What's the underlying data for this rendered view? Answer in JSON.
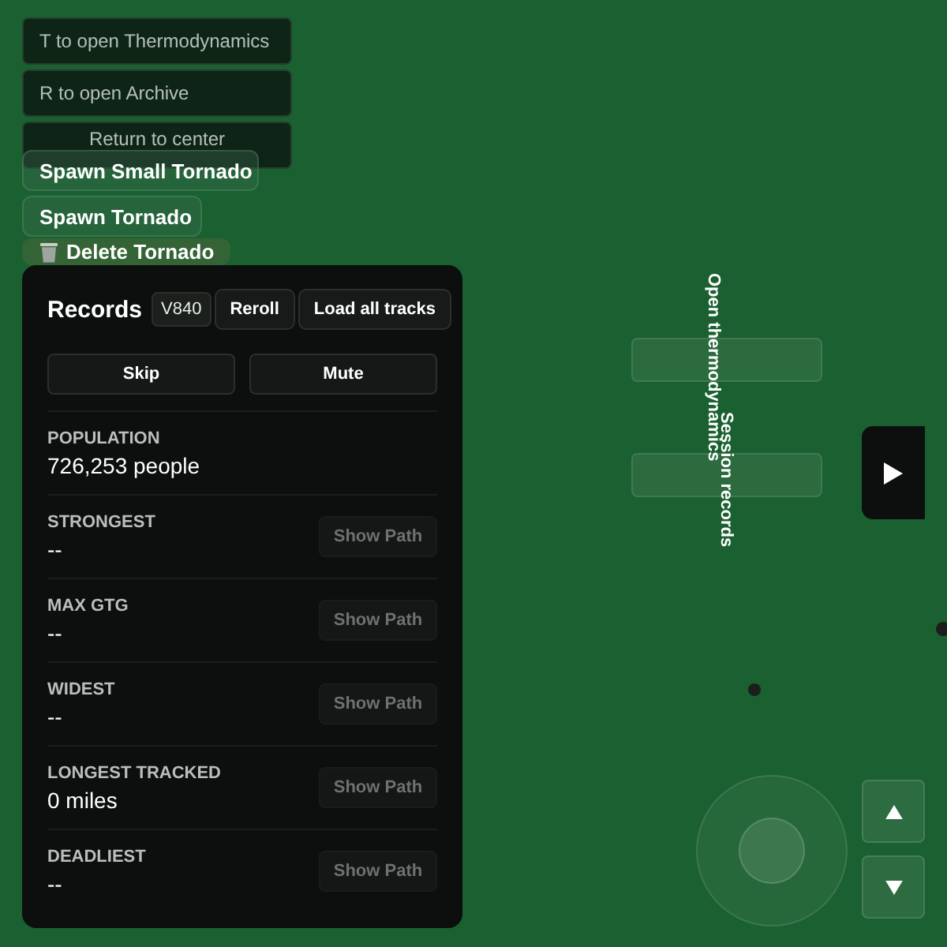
{
  "hints": [
    {
      "text": "T to open Thermodynamics"
    },
    {
      "text": "R to open Archive"
    }
  ],
  "return_button": {
    "label": "Return to center"
  },
  "spawn_buttons": [
    {
      "label": "Spawn Small Tornado",
      "kind": "spawn"
    },
    {
      "label": "Spawn Tornado",
      "kind": "spawn"
    },
    {
      "label": "Delete Tornado",
      "kind": "delete"
    }
  ],
  "records": {
    "title": "Records",
    "version": "V840",
    "header_buttons": [
      "Reroll",
      "Load all tracks"
    ],
    "actions": [
      "Skip",
      "Mute"
    ],
    "stats": [
      {
        "label": "POPULATION",
        "value": "726,253 people"
      },
      {
        "label": "STRONGEST",
        "value": "--",
        "show_path": {
          "label": "Show Path",
          "disabled": true
        }
      },
      {
        "label": "MAX GTG",
        "value": "--",
        "show_path": {
          "label": "Show Path",
          "disabled": true
        }
      },
      {
        "label": "WIDEST",
        "value": "--",
        "show_path": {
          "label": "Show Path",
          "disabled": true
        }
      },
      {
        "label": "LONGEST TRACKED",
        "value": "0 miles",
        "show_path": {
          "label": "Show Path",
          "disabled": true
        }
      },
      {
        "label": "DEADLIEST",
        "value": "--",
        "show_path": {
          "label": "Show Path",
          "disabled": true
        }
      }
    ]
  },
  "side_tabs": [
    {
      "label": "Open thermodynamics"
    },
    {
      "label": "Session records"
    }
  ]
}
